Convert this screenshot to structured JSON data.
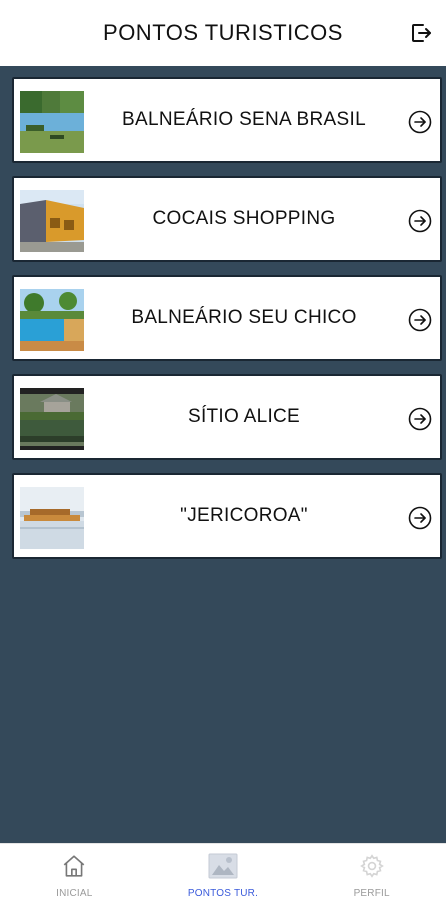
{
  "header": {
    "title": "PONTOS TURISTICOS",
    "logout_icon": "logout-icon"
  },
  "places": [
    {
      "label": "BALNEÁRIO SENA BRASIL",
      "image": "pool-park-photo"
    },
    {
      "label": "COCAIS SHOPPING",
      "image": "shopping-building-photo"
    },
    {
      "label": "BALNEÁRIO SEU CHICO",
      "image": "pool-photo"
    },
    {
      "label": "SÍTIO ALICE",
      "image": "lake-photo"
    },
    {
      "label": "\"JERICOROA\"",
      "image": "river-boat-photo"
    }
  ],
  "nav": [
    {
      "label": "INICIAL",
      "icon": "home-icon",
      "active": false
    },
    {
      "label": "PONTOS TUR.",
      "icon": "image-icon",
      "active": true
    },
    {
      "label": "PERFIL",
      "icon": "gear-icon",
      "active": false
    }
  ],
  "colors": {
    "background": "#34495a",
    "card_border": "#1a2733",
    "nav_active": "#3b5bdb",
    "nav_inactive": "#9a9a9a"
  }
}
